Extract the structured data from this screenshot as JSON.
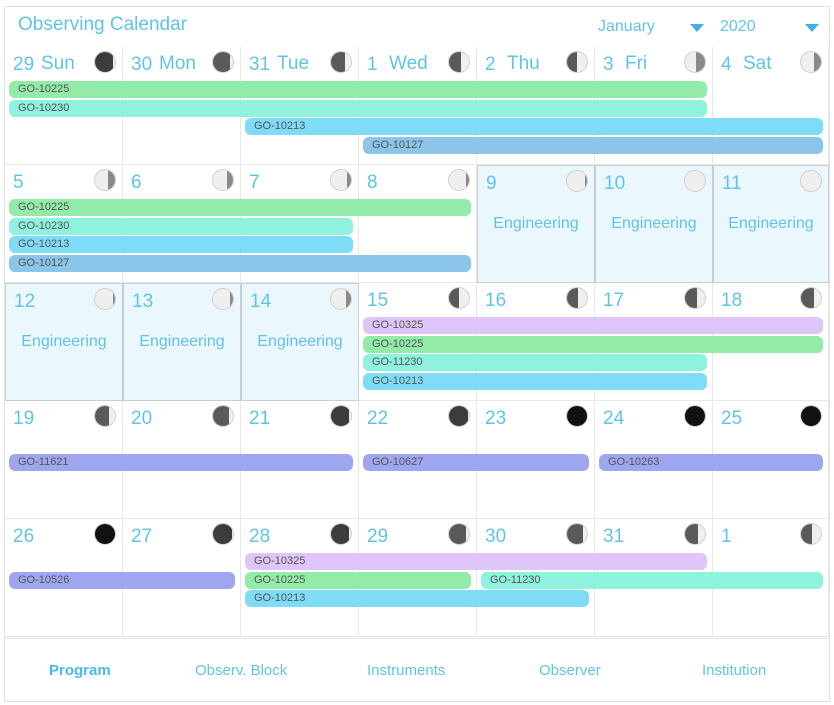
{
  "header": {
    "title": "Observing Calendar",
    "month": "January",
    "year": "2020"
  },
  "weeks": [
    [
      {
        "day": "29",
        "weekday": "Sun",
        "moon": 0.9
      },
      {
        "day": "30",
        "weekday": "Mon",
        "moon": 0.85
      },
      {
        "day": "31",
        "weekday": "Tue",
        "moon": 0.7
      },
      {
        "day": "1",
        "weekday": "Wed",
        "moon": 0.6
      },
      {
        "day": "2",
        "weekday": "Thu",
        "moon": 0.5
      },
      {
        "day": "3",
        "weekday": "Fri",
        "moon": 0.4
      },
      {
        "day": "4",
        "weekday": "Sat",
        "moon": 0.3
      }
    ],
    [
      {
        "day": "5",
        "moon": 0.3
      },
      {
        "day": "6",
        "moon": 0.25
      },
      {
        "day": "7",
        "moon": 0.15
      },
      {
        "day": "8",
        "moon": 0.1
      },
      {
        "day": "9",
        "moon": 0.05,
        "label": "Engineering"
      },
      {
        "day": "10",
        "moon": 0,
        "label": "Engineering"
      },
      {
        "day": "11",
        "moon": 0,
        "label": "Engineering"
      }
    ],
    [
      {
        "day": "12",
        "moon": 0.05,
        "label": "Engineering"
      },
      {
        "day": "13",
        "moon": 0.1,
        "label": "Engineering"
      },
      {
        "day": "14",
        "moon": 0.2,
        "label": "Engineering"
      },
      {
        "day": "15",
        "moon": 0.5
      },
      {
        "day": "16",
        "moon": 0.55
      },
      {
        "day": "17",
        "moon": 0.6
      },
      {
        "day": "18",
        "moon": 0.65
      }
    ],
    [
      {
        "day": "19",
        "moon": 0.7
      },
      {
        "day": "20",
        "moon": 0.8
      },
      {
        "day": "21",
        "moon": 0.9
      },
      {
        "day": "22",
        "moon": 0.95
      },
      {
        "day": "23",
        "moon": 1
      },
      {
        "day": "24",
        "moon": 1
      },
      {
        "day": "25",
        "moon": 1
      }
    ],
    [
      {
        "day": "26",
        "moon": 1
      },
      {
        "day": "27",
        "moon": 0.97
      },
      {
        "day": "28",
        "moon": 0.92
      },
      {
        "day": "29",
        "moon": 0.85
      },
      {
        "day": "30",
        "moon": 0.8
      },
      {
        "day": "31",
        "moon": 0.65
      },
      {
        "day": "1",
        "moon": 0.55
      }
    ]
  ],
  "events": [
    {
      "id": "GO-10225",
      "week": 0,
      "row": 0,
      "start": 0,
      "end": 6.0,
      "color": "#93ebaa"
    },
    {
      "id": "GO-10230",
      "week": 0,
      "row": 1,
      "start": 0,
      "end": 6.0,
      "color": "#8ef2de"
    },
    {
      "id": "GO-10213",
      "week": 0,
      "row": 2,
      "start": 2,
      "end": 7,
      "color": "#7fdcf6"
    },
    {
      "id": "GO-10127",
      "week": 0,
      "row": 3,
      "start": 3,
      "end": 7,
      "color": "#8bc5ea"
    },
    {
      "id": "GO-10225",
      "week": 1,
      "row": 0,
      "start": 0,
      "end": 4.0,
      "color": "#93ebaa"
    },
    {
      "id": "GO-10230",
      "week": 1,
      "row": 1,
      "start": 0,
      "end": 3.0,
      "color": "#8ef2de"
    },
    {
      "id": "GO-10213",
      "week": 1,
      "row": 2,
      "start": 0,
      "end": 3.0,
      "color": "#7fdcf6"
    },
    {
      "id": "GO-10127",
      "week": 1,
      "row": 3,
      "start": 0,
      "end": 4.0,
      "color": "#8bc5ea"
    },
    {
      "id": "GO-10325",
      "week": 2,
      "row": 0,
      "start": 3,
      "end": 7,
      "color": "#dfc5f8"
    },
    {
      "id": "GO-10225",
      "week": 2,
      "row": 1,
      "start": 3,
      "end": 7,
      "color": "#93ebaa"
    },
    {
      "id": "GO-11230",
      "week": 2,
      "row": 2,
      "start": 3,
      "end": 6.0,
      "color": "#8ef2de"
    },
    {
      "id": "GO-10213",
      "week": 2,
      "row": 3,
      "start": 3,
      "end": 6.0,
      "color": "#7fdcf6"
    },
    {
      "id": "GO-11621",
      "week": 3,
      "row": 1,
      "start": 0,
      "end": 3,
      "color": "#9fa6f0"
    },
    {
      "id": "GO-10627",
      "week": 3,
      "row": 1,
      "start": 3,
      "end": 5,
      "color": "#9fa6f0"
    },
    {
      "id": "GO-10263",
      "week": 3,
      "row": 1,
      "start": 5,
      "end": 7,
      "color": "#9fa6f0"
    },
    {
      "id": "GO-10526",
      "week": 4,
      "row": 1,
      "start": 0,
      "end": 2,
      "color": "#9fa6f0"
    },
    {
      "id": "GO-10325",
      "week": 4,
      "row": 0,
      "start": 2,
      "end": 6.0,
      "color": "#dfc5f8"
    },
    {
      "id": "GO-10225",
      "week": 4,
      "row": 1,
      "start": 2,
      "end": 4,
      "color": "#93ebaa"
    },
    {
      "id": "GO-11230",
      "week": 4,
      "row": 1,
      "start": 4,
      "end": 7,
      "color": "#8ef2de"
    },
    {
      "id": "GO-10213",
      "week": 4,
      "row": 2,
      "start": 2,
      "end": 5,
      "color": "#7fdcf6"
    }
  ],
  "nav": {
    "tabs": [
      "Program",
      "Observ. Block",
      "Instruments",
      "Observer",
      "Institution"
    ],
    "active": 0
  }
}
